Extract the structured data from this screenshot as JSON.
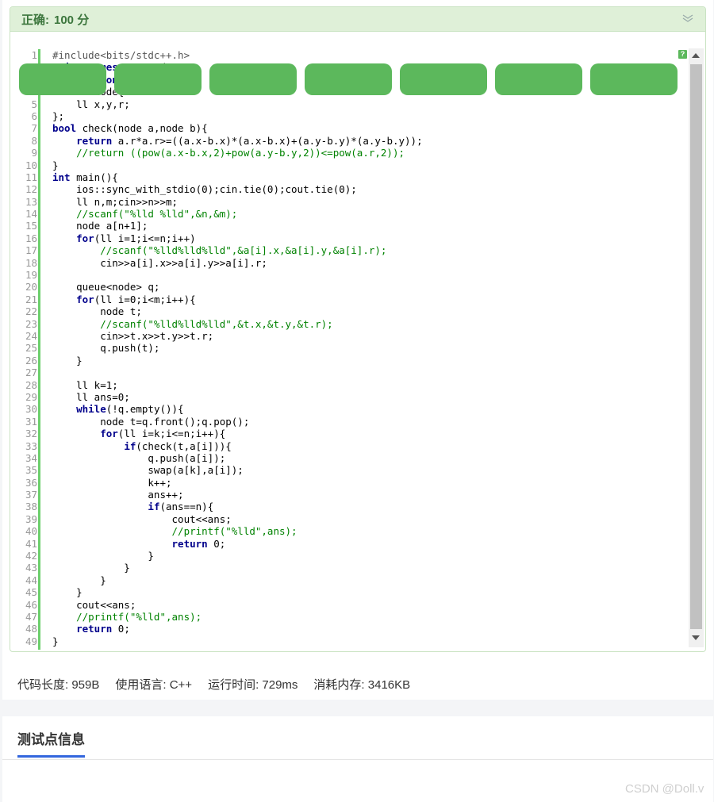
{
  "result": {
    "status": "正确:",
    "score": "100 分"
  },
  "code_lines": [
    "#include<bits/stdc++.h>",
    "using namespace std;",
    "typedef long long ll;",
    "struct node{",
    "    ll x,y,r;",
    "};",
    "bool check(node a,node b){",
    "    return a.r*a.r>=((a.x-b.x)*(a.x-b.x)+(a.y-b.y)*(a.y-b.y));",
    "    //return ((pow(a.x-b.x,2)+pow(a.y-b.y,2))<=pow(a.r,2));",
    "}",
    "int main(){",
    "    ios::sync_with_stdio(0);cin.tie(0);cout.tie(0);",
    "    ll n,m;cin>>n>>m;",
    "    //scanf(\"%lld %lld\",&n,&m);",
    "    node a[n+1];",
    "    for(ll i=1;i<=n;i++)",
    "        //scanf(\"%lld%lld%lld\",&a[i].x,&a[i].y,&a[i].r);",
    "        cin>>a[i].x>>a[i].y>>a[i].r;",
    "",
    "    queue<node> q;",
    "    for(ll i=0;i<m;i++){",
    "        node t;",
    "        //scanf(\"%lld%lld%lld\",&t.x,&t.y,&t.r);",
    "        cin>>t.x>>t.y>>t.r;",
    "        q.push(t);",
    "    }",
    "",
    "    ll k=1;",
    "    ll ans=0;",
    "    while(!q.empty()){",
    "        node t=q.front();q.pop();",
    "        for(ll i=k;i<=n;i++){",
    "            if(check(t,a[i])){",
    "                q.push(a[i]);",
    "                swap(a[k],a[i]);",
    "                k++;",
    "                ans++;",
    "                if(ans==n){",
    "                    cout<<ans;",
    "                    //printf(\"%lld\",ans);",
    "                    return 0;",
    "                }",
    "            }",
    "        }",
    "    }",
    "    cout<<ans;",
    "    //printf(\"%lld\",ans);",
    "    return 0;",
    "}"
  ],
  "stats": {
    "code_length": "代码长度: 959B",
    "language": "使用语言: C++",
    "run_time": "运行时间: 729ms",
    "memory": "消耗内存: 3416KB"
  },
  "tests": {
    "title": "测试点信息",
    "count_visible": 7,
    "pill_color": "#5cb85c"
  },
  "watermark": "CSDN @Doll.v",
  "colors": {
    "accent_green": "#5cb85c",
    "header_bg": "#dff0d8",
    "tab_underline": "#3366dd"
  }
}
